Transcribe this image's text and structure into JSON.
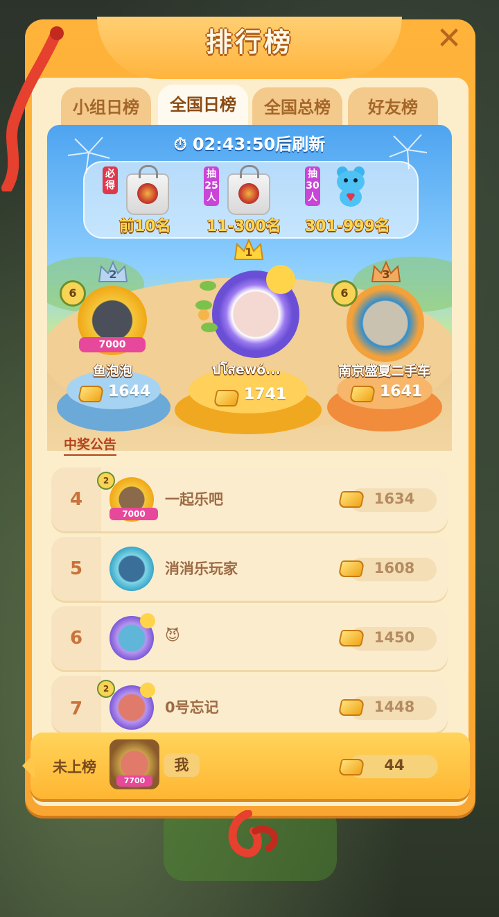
{
  "title": "排行榜",
  "tabs": [
    {
      "label": "小组日榜",
      "active": false
    },
    {
      "label": "全国日榜",
      "active": true
    },
    {
      "label": "全国总榜",
      "active": false
    },
    {
      "label": "好友榜",
      "active": false
    }
  ],
  "timer": "02:43:50后刷新",
  "rewards": [
    {
      "badge": "必得",
      "label": "前10名",
      "icon": "gift-bag-icon"
    },
    {
      "badge": "抽25人",
      "label": "11-300名",
      "icon": "gift-bag-icon"
    },
    {
      "badge": "抽30人",
      "label": "301-999名",
      "icon": "blue-bear-plush-icon"
    }
  ],
  "podium": {
    "first": {
      "rank": "1",
      "name": "ปโสewό...",
      "score": "1741"
    },
    "second": {
      "rank": "2",
      "name": "鱼泡泡",
      "score": "1644",
      "level": "6",
      "frame_text": "7000"
    },
    "third": {
      "rank": "3",
      "name": "南京盛夏二手车",
      "score": "1641",
      "level": "6"
    }
  },
  "announcement": "中奖公告",
  "list": [
    {
      "rank": "4",
      "name": "一起乐吧",
      "score": "1634",
      "level": "2",
      "frame_text": "7000"
    },
    {
      "rank": "5",
      "name": "消消乐玩家",
      "score": "1608"
    },
    {
      "rank": "6",
      "name": "😈",
      "score": "1450"
    },
    {
      "rank": "7",
      "name": "0号忘记",
      "score": "1448",
      "level": "2"
    }
  ],
  "me": {
    "label": "未上榜",
    "name": "我",
    "score": "44",
    "frame_text": "7700"
  },
  "colors": {
    "panel_orange": "#ffb33a",
    "panel_inner": "#fdeecb",
    "rank_text": "#c9723a",
    "gold": "#f1a51a"
  }
}
